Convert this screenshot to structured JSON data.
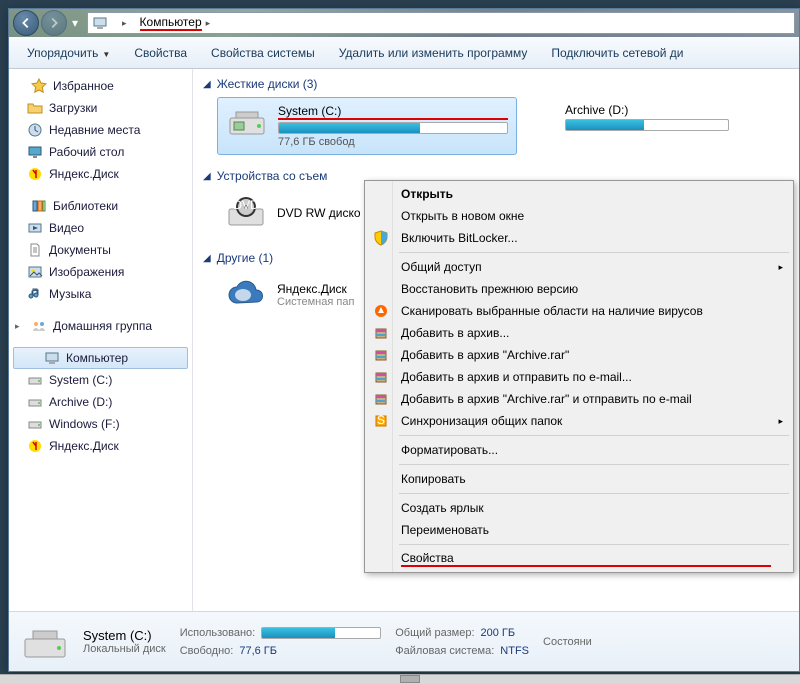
{
  "breadcrumb": {
    "root": "Компьютер"
  },
  "toolbar": {
    "organize": "Упорядочить",
    "properties": "Свойства",
    "system_properties": "Свойства системы",
    "uninstall": "Удалить или изменить программу",
    "map_drive": "Подключить сетевой ди"
  },
  "nav": {
    "favorites": {
      "label": "Избранное",
      "items": [
        "Загрузки",
        "Недавние места",
        "Рабочий стол",
        "Яндекс.Диск"
      ]
    },
    "libraries": {
      "label": "Библиотеки",
      "items": [
        "Видео",
        "Документы",
        "Изображения",
        "Музыка"
      ]
    },
    "homegroup": "Домашняя группа",
    "computer": {
      "label": "Компьютер",
      "items": [
        "System (C:)",
        "Archive (D:)",
        "Windows (F:)",
        "Яндекс.Диск"
      ]
    }
  },
  "sections": {
    "drives": {
      "title": "Жесткие диски (3)",
      "items": [
        {
          "name": "System (C:)",
          "free": "77,6 ГБ свобод",
          "fill_pct": 62
        },
        {
          "name": "Archive (D:)",
          "free": "",
          "fill_pct": 48
        }
      ]
    },
    "removable": {
      "title": "Устройства со съем",
      "items": [
        {
          "name": "DVD RW диско"
        }
      ]
    },
    "other": {
      "title": "Другие (1)",
      "items": [
        {
          "name": "Яндекс.Диск",
          "sub": "Системная пап"
        }
      ]
    }
  },
  "context_menu": {
    "open": "Открыть",
    "open_new": "Открыть в новом окне",
    "bitlocker": "Включить BitLocker...",
    "share": "Общий доступ",
    "restore": "Восстановить прежнюю версию",
    "scan": "Сканировать выбранные области на наличие вирусов",
    "add_archive": "Добавить в архив...",
    "add_archive_rar": "Добавить в архив \"Archive.rar\"",
    "add_email": "Добавить в архив и отправить по e-mail...",
    "add_rar_email": "Добавить в архив \"Archive.rar\" и отправить по e-mail",
    "sync": "Синхронизация общих папок",
    "format": "Форматировать...",
    "copy": "Копировать",
    "shortcut": "Создать ярлык",
    "rename": "Переименовать",
    "properties": "Свойства"
  },
  "details": {
    "name": "System (C:)",
    "type": "Локальный диск",
    "used_label": "Использовано:",
    "free_label": "Свободно:",
    "free_value": "77,6 ГБ",
    "size_label": "Общий размер:",
    "size_value": "200 ГБ",
    "fs_label": "Файловая система:",
    "fs_value": "NTFS",
    "state_label": "Состояни",
    "fill_pct": 62
  }
}
